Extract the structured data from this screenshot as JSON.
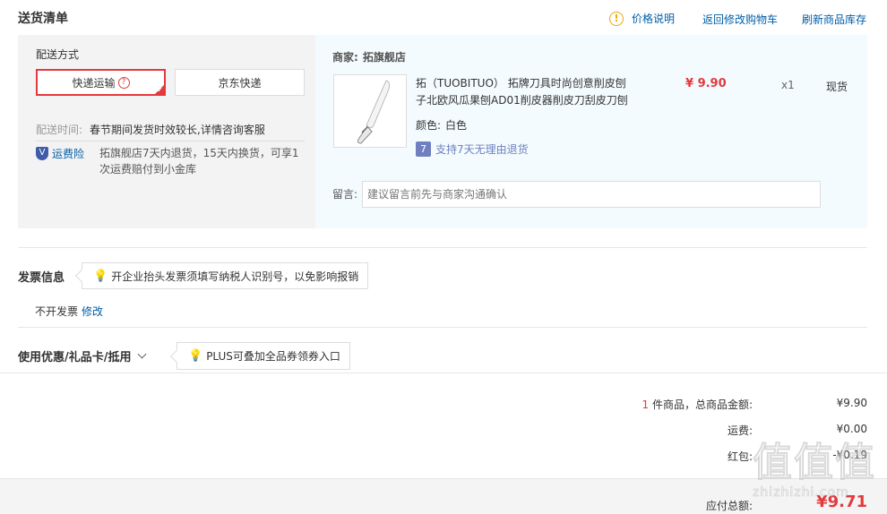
{
  "header": {
    "title": "送货清单",
    "price_note": "价格说明",
    "back_to_cart": "返回修改购物车",
    "refresh_stock": "刷新商品库存"
  },
  "shipping": {
    "section_label": "配送方式",
    "options": [
      {
        "label": "快递运输",
        "selected": true
      },
      {
        "label": "京东快递",
        "selected": false
      }
    ],
    "time_label": "配送时间:",
    "time_value": "春节期间发货时效较长,详情咨询客服",
    "insurance_label": "运费险",
    "insurance_text": "拓旗舰店7天内退货，15天内换货，可享1次运费赔付到小金库"
  },
  "merchant": {
    "label": "商家:",
    "name": "拓旗舰店"
  },
  "product": {
    "name": "拓（TUOBITUO） 拓牌刀具时尚创意削皮刨子北欧风瓜果刨AD01削皮器削皮刀刮皮刀刨",
    "price": "¥ 9.90",
    "quantity": "x1",
    "stock": "现货",
    "color_label": "颜色:",
    "color_value": "白色",
    "return_badge": "7",
    "return_text": "支持7天无理由退货",
    "note_label": "留言:",
    "note_placeholder": "建议留言前先与商家沟通确认"
  },
  "invoice": {
    "title": "发票信息",
    "tip": "开企业抬头发票须填写纳税人识别号，以免影响报销",
    "status": "不开发票",
    "edit": "修改"
  },
  "coupon": {
    "title": "使用优惠/礼品卡/抵用",
    "tip": "PLUS可叠加全品券领券入口"
  },
  "summary": {
    "count": "1",
    "count_suffix": "件商品，总商品金额:",
    "goods_total": "¥9.90",
    "shipping_label": "运费:",
    "shipping_value": "¥0.00",
    "redpacket_label": "红包:",
    "redpacket_value": "-¥0.19",
    "payable_label": "应付总额:",
    "payable_value": "¥9.71"
  },
  "watermark": "值 什么值得买 zhizhizhi.com",
  "colors": {
    "accent_red": "#e4393c",
    "link_blue": "#005ea7",
    "panel_bg": "#f3f3f3",
    "shop_bg": "#f3fbfe"
  }
}
